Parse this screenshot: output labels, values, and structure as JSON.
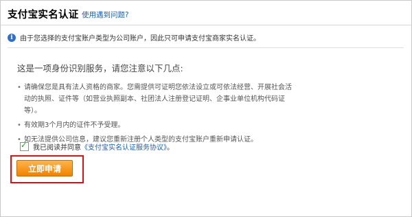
{
  "header": {
    "title": "支付宝实名认证",
    "help_link": "使用遇到问题?"
  },
  "notice": {
    "icon": "info-icon",
    "text": "由于您选择的支付宝账户类型为公司账户，因此只可申请支付宝商家实名认证。"
  },
  "main": {
    "intro": "这是一项身份识别服务，请您注意以下几点:",
    "bullets": [
      "请确保您是具有法人资格的商家。您需提供可证明您依法设立或可依法经营、开展社会活动的执照、证件等（如营业执照副本、社团法人注册登记证明、企事业单位机构代码证等）。",
      "有效期3个月内的证件不予受理。",
      "如无法提供公司信息，建议您重新注册个人类型的支付宝账户重新申请认证。"
    ]
  },
  "agreement": {
    "checked": true,
    "text": "我已阅读并同意",
    "link": "《支付宝实名认证服务协议》",
    "end": "。"
  },
  "apply_button": {
    "label": "立即申请"
  },
  "colors": {
    "link": "#1a5fb4",
    "button": "#f08300",
    "highlight": "#e01010"
  }
}
